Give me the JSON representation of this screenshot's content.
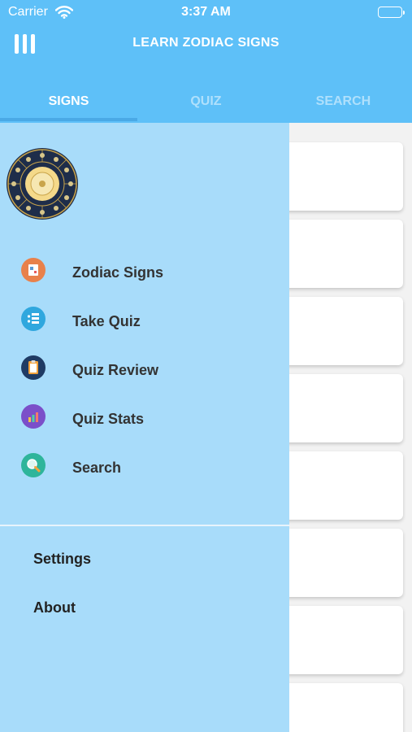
{
  "status_bar": {
    "carrier": "Carrier",
    "time": "3:37 AM"
  },
  "header": {
    "title": "LEARN ZODIAC SIGNS"
  },
  "tabs": [
    {
      "label": "SIGNS",
      "active": true
    },
    {
      "label": "QUIZ",
      "active": false
    },
    {
      "label": "SEARCH",
      "active": false
    }
  ],
  "drawer": {
    "items": [
      {
        "label": "Zodiac Signs",
        "icon": "zodiac-signs-icon"
      },
      {
        "label": "Take Quiz",
        "icon": "take-quiz-icon"
      },
      {
        "label": "Quiz Review",
        "icon": "quiz-review-icon"
      },
      {
        "label": "Quiz Stats",
        "icon": "quiz-stats-icon"
      },
      {
        "label": "Search",
        "icon": "search-icon"
      }
    ],
    "bottom_items": [
      {
        "label": "Settings"
      },
      {
        "label": "About"
      }
    ]
  },
  "colors": {
    "header": "#5ec0f8",
    "drawer": "#a8dcfa",
    "tab_underline": "#4aa9e6"
  }
}
